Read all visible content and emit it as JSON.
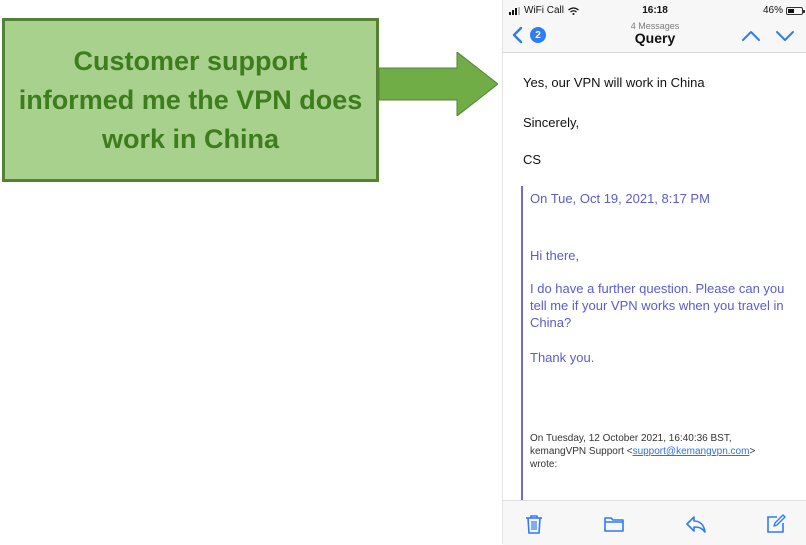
{
  "callout": {
    "text": "Customer support informed me the VPN does work in China"
  },
  "status_bar": {
    "carrier": "WiFi Call",
    "time": "16:18",
    "battery": "46%",
    "battery_level": 0.46
  },
  "nav": {
    "back_count": "2",
    "subtitle": "4 Messages",
    "title": "Query"
  },
  "email": {
    "reply_lines": [
      "Yes, our VPN will work in China",
      "Sincerely,",
      "CS"
    ],
    "quoted": {
      "date_line": "On Tue, Oct 19, 2021, 8:17 PM",
      "greeting": "Hi there,",
      "body": "I do have a further question. Please can you tell me if your VPN works when you travel in China?",
      "thanks": "Thank you.",
      "header_line1": "On Tuesday, 12 October 2021, 16:40:36 BST,",
      "header_sender": "kemangVPN Support <",
      "header_email": "support@kemangvpn.com",
      "header_close": ">",
      "header_wrote": "wrote:"
    }
  },
  "colors": {
    "callout_fill": "#a9d18e",
    "callout_border": "#548235",
    "callout_text": "#3e7d1e",
    "ios_blue": "#2f7cf6",
    "quote_purple": "#5b5bd4"
  },
  "icons": {
    "toolbar": [
      "trash-icon",
      "folder-icon",
      "reply-icon",
      "compose-icon"
    ],
    "nav": [
      "back-chevron-icon",
      "up-arrow-icon",
      "down-arrow-icon"
    ]
  }
}
